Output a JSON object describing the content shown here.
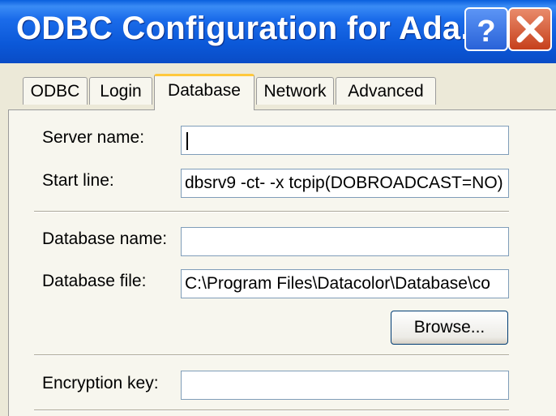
{
  "window": {
    "title": "ODBC Configuration for Ada..."
  },
  "title_buttons": {
    "help": "?",
    "close_icon": "close-icon"
  },
  "tabs": [
    {
      "label": "ODBC"
    },
    {
      "label": "Login"
    },
    {
      "label": "Database",
      "active": true
    },
    {
      "label": "Network"
    },
    {
      "label": "Advanced"
    }
  ],
  "form": {
    "server_name": {
      "label": "Server name:",
      "value": ""
    },
    "start_line": {
      "label": "Start line:",
      "value": "dbsrv9 -ct- -x tcpip(DOBROADCAST=NO)"
    },
    "database_name": {
      "label": "Database name:",
      "value": ""
    },
    "database_file": {
      "label": "Database file:",
      "value": "C:\\Program Files\\Datacolor\\Database\\co"
    },
    "browse_button": "Browse...",
    "encryption_key": {
      "label": "Encryption key:",
      "value": ""
    }
  },
  "colors": {
    "titlebar": "#0a5fde",
    "face": "#ece9d8",
    "active_tab_accent": "#ffc83c",
    "close": "#c6401c"
  }
}
